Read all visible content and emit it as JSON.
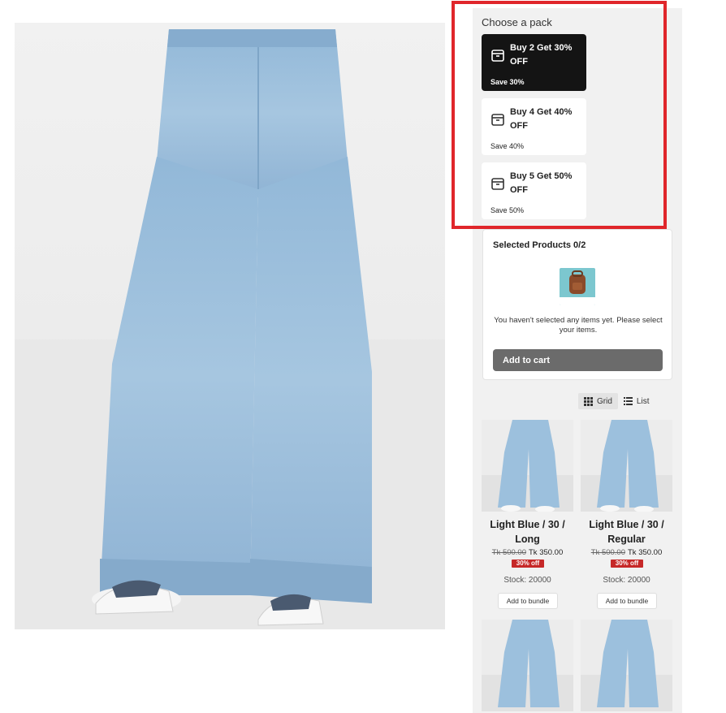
{
  "pack_section": {
    "title": "Choose a pack",
    "packs": [
      {
        "label": "Buy 2 Get 30% OFF",
        "save": "Save 30%",
        "selected": true
      },
      {
        "label": "Buy 4 Get 40% OFF",
        "save": "Save 40%",
        "selected": false
      },
      {
        "label": "Buy 5 Get 50% OFF",
        "save": "Save 50%",
        "selected": false
      }
    ]
  },
  "selected": {
    "title": "Selected Products 0/2",
    "empty_message": "You haven't selected any items yet. Please select your items.",
    "add_to_cart": "Add to cart"
  },
  "view": {
    "grid_label": "Grid",
    "list_label": "List",
    "active": "grid"
  },
  "products": [
    {
      "name": "Light Blue / 30 / Long",
      "old_price": "Tk 500.00",
      "price": "Tk 350.00",
      "badge": "30% off",
      "stock": "Stock: 20000",
      "button": "Add to bundle"
    },
    {
      "name": "Light Blue / 30 / Regular",
      "old_price": "Tk 500.00",
      "price": "Tk 350.00",
      "badge": "30% off",
      "stock": "Stock: 20000",
      "button": "Add to bundle"
    }
  ],
  "colors": {
    "highlight": "#e0262b",
    "active_pack": "#141414",
    "badge": "#c62828",
    "denim": "#9cc0dd"
  }
}
